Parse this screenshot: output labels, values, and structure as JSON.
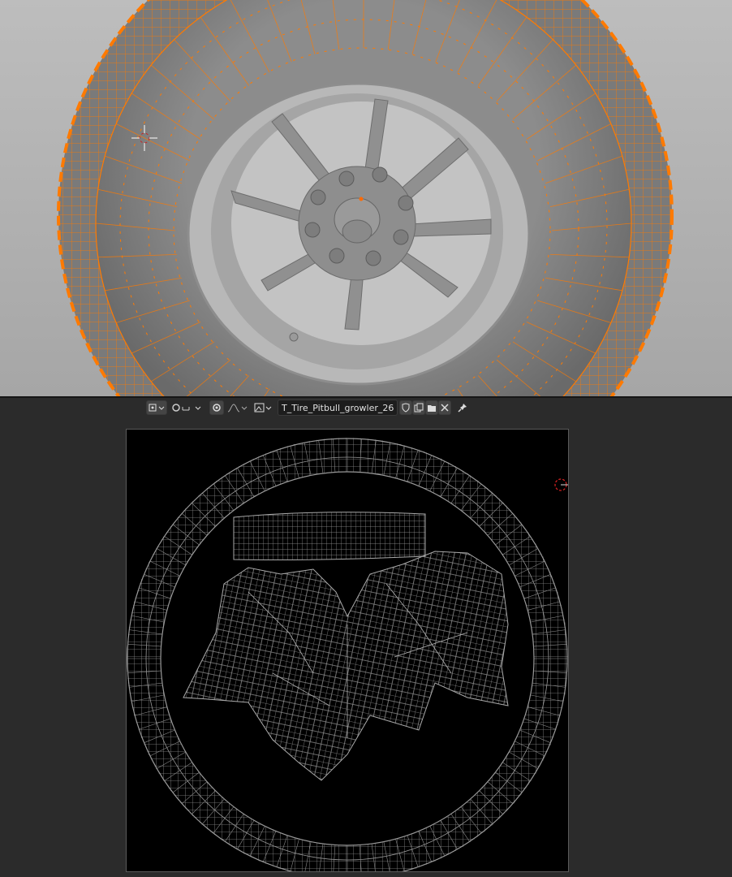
{
  "viewport": {
    "name": "3D Viewport",
    "selection_color": "#ff7a00",
    "tire_color": "#8f8f8f",
    "rim_color": "#8a8a8a"
  },
  "uv_editor": {
    "header": {
      "icons": [
        "selection-mode-icon",
        "sticky-selection-icon",
        "pivot-icon",
        "proportional-editing-icon",
        "falloff-icon",
        "image-browse-icon"
      ],
      "image_name": "T_Tire_Pitbull_growler_26",
      "actions": [
        "fake-user-icon",
        "new-image-icon",
        "open-image-icon",
        "unlink-icon",
        "pin-icon"
      ]
    },
    "wire_color": "#8a8a8a",
    "background": "#000000"
  }
}
